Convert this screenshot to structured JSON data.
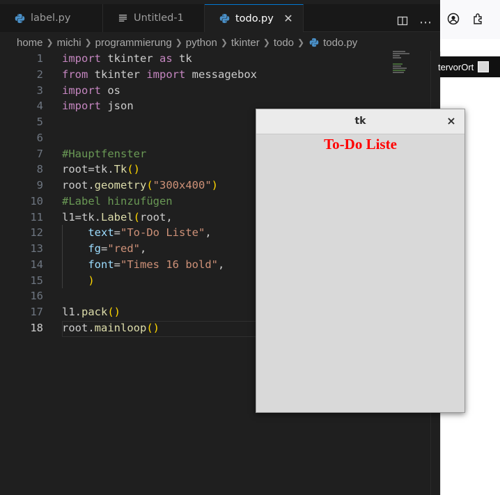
{
  "tabs": [
    {
      "label": "label.py",
      "icon": "python-icon",
      "active": false
    },
    {
      "label": "Untitled-1",
      "icon": "file-lines-icon",
      "active": false
    },
    {
      "label": "todo.py",
      "icon": "python-icon",
      "active": true
    }
  ],
  "tab_actions": {
    "split": "split-editor-icon",
    "more": "⋯"
  },
  "breadcrumb": [
    "home",
    "michi",
    "programmierung",
    "python",
    "tkinter",
    "todo",
    "todo.py"
  ],
  "line_numbers": [
    "1",
    "2",
    "3",
    "4",
    "5",
    "6",
    "7",
    "8",
    "9",
    "10",
    "11",
    "12",
    "13",
    "14",
    "15",
    "16",
    "17",
    "18"
  ],
  "current_line": "18",
  "code": {
    "l1": {
      "kw1": "import",
      "a": " tkinter ",
      "kw2": "as",
      "b": " tk"
    },
    "l2": {
      "kw1": "from",
      "a": " tkinter ",
      "kw2": "import",
      "b": " messagebox"
    },
    "l3": {
      "kw1": "import",
      "a": " os"
    },
    "l4": {
      "kw1": "import",
      "a": " json"
    },
    "l7": {
      "comment": "#Hauptfenster"
    },
    "l8": {
      "a": "root=tk.",
      "fn": "Tk",
      "br": "()"
    },
    "l9": {
      "a": "root.",
      "fn": "geometry",
      "br1": "(",
      "str": "\"300x400\"",
      "br2": ")"
    },
    "l10": {
      "comment": "#Label hinzufügen"
    },
    "l11": {
      "a": "l1=tk.",
      "fn": "Label",
      "br": "(",
      "b": "root,"
    },
    "l12": {
      "indent": "    ",
      "param": "text",
      "eq": "=",
      "str": "\"To-Do Liste\"",
      "c": ","
    },
    "l13": {
      "indent": "    ",
      "param": "fg",
      "eq": "=",
      "str": "\"red\"",
      "c": ","
    },
    "l14": {
      "indent": "    ",
      "param": "font",
      "eq": "=",
      "str": "\"Times 16 bold\"",
      "c": ","
    },
    "l15": {
      "indent": "    ",
      "br": ")"
    },
    "l17": {
      "a": "l1.",
      "fn": "pack",
      "br": "()"
    },
    "l18": {
      "a": "root.",
      "fn": "mainloop",
      "br": "()"
    }
  },
  "tk_window": {
    "title": "tk",
    "close": "×",
    "label_text": "To-Do Liste",
    "label_color": "#ff0000"
  },
  "browser": {
    "user_text": "tervorOrt"
  },
  "colors": {
    "editor_bg": "#1f1f1f",
    "keyword": "#c586c0",
    "function": "#dcdcaa",
    "string": "#ce9178",
    "comment": "#6a9955",
    "parameter": "#9cdcfe",
    "bracket": "#ffd700",
    "accent": "#0078d4"
  }
}
